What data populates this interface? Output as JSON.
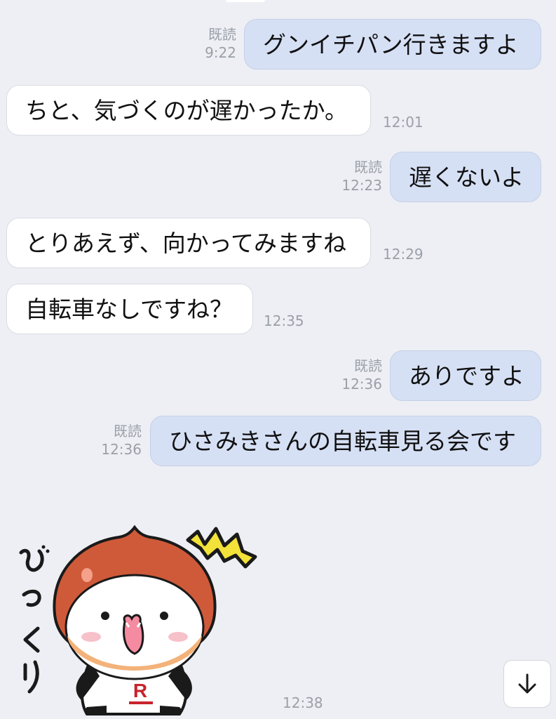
{
  "messages": [
    {
      "dir": "out",
      "text": "グンイチパン行きますよ",
      "read": "既読",
      "time": "9:22"
    },
    {
      "dir": "in",
      "text": "ちと、気づくのが遅かったか。",
      "time": "12:01"
    },
    {
      "dir": "out",
      "text": "遅くないよ",
      "read": "既読",
      "time": "12:23"
    },
    {
      "dir": "in",
      "text": "とりあえず、向かってみますね",
      "time": "12:29"
    },
    {
      "dir": "in",
      "text": "自転車なしですね？",
      "time": "12:35"
    },
    {
      "dir": "out",
      "text": "ありですよ",
      "read": "既読",
      "time": "12:36"
    },
    {
      "dir": "out",
      "text": "ひさみきさんの自転車見る会です",
      "read": "既読",
      "time": "12:36"
    }
  ],
  "sticker": {
    "caption": "びっくり",
    "badge": "R",
    "time": "12:38"
  },
  "scroll_button": {
    "icon": "arrow-down-icon"
  },
  "colors": {
    "background": "#edeff4",
    "outgoing_bubble": "#d6e0f5",
    "incoming_bubble": "#ffffff",
    "meta_text": "#9b9fa8",
    "sticker_hood": "#cf5a3a"
  }
}
